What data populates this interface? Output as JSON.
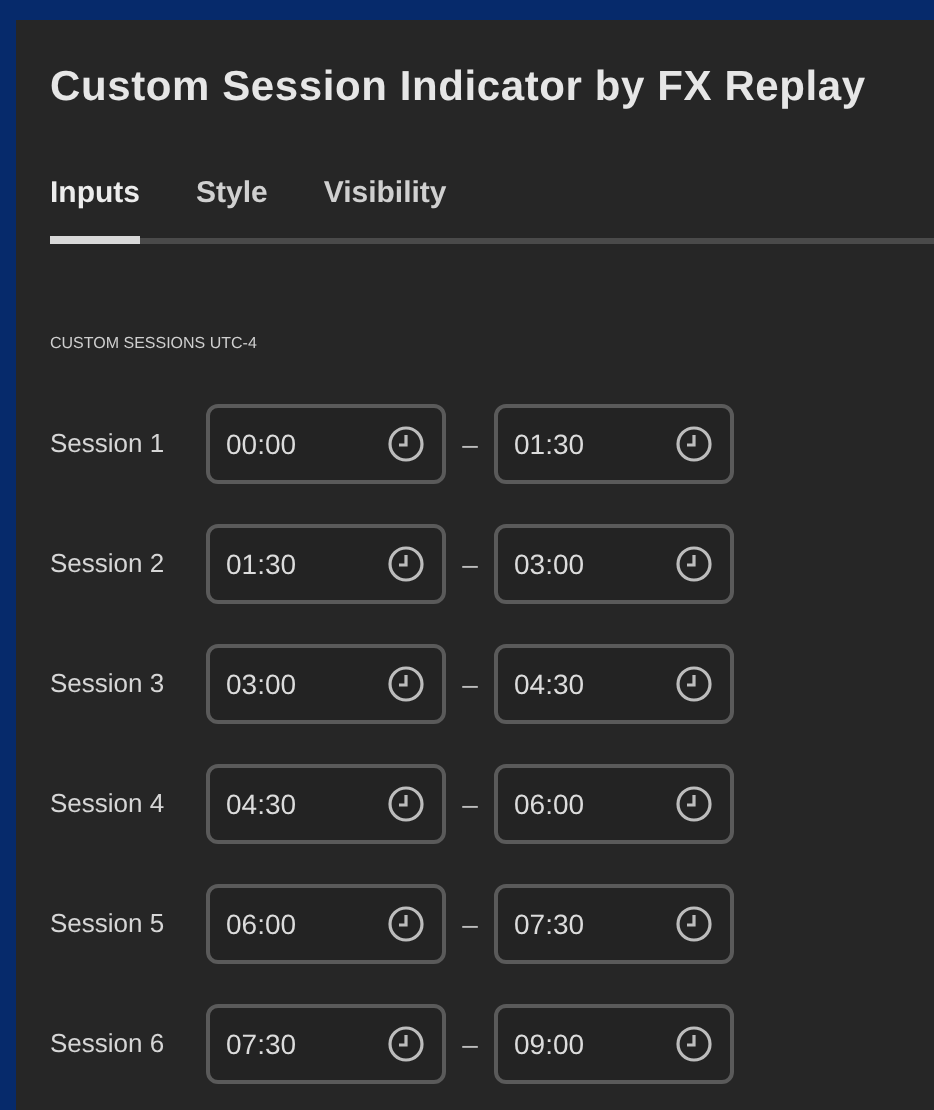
{
  "dialog": {
    "title": "Custom Session Indicator by FX Replay"
  },
  "tabs": [
    {
      "label": "Inputs",
      "selected": true
    },
    {
      "label": "Style",
      "selected": false
    },
    {
      "label": "Visibility",
      "selected": false
    }
  ],
  "section": {
    "heading": "CUSTOM SESSIONS UTC-4"
  },
  "sessions": [
    {
      "label": "Session 1",
      "start": "00:00",
      "separator": "–",
      "end": "01:30"
    },
    {
      "label": "Session 2",
      "start": "01:30",
      "separator": "–",
      "end": "03:00"
    },
    {
      "label": "Session 3",
      "start": "03:00",
      "separator": "–",
      "end": "04:30"
    },
    {
      "label": "Session 4",
      "start": "04:30",
      "separator": "–",
      "end": "06:00"
    },
    {
      "label": "Session 5",
      "start": "06:00",
      "separator": "–",
      "end": "07:30"
    },
    {
      "label": "Session 6",
      "start": "07:30",
      "separator": "–",
      "end": "09:00"
    }
  ]
}
